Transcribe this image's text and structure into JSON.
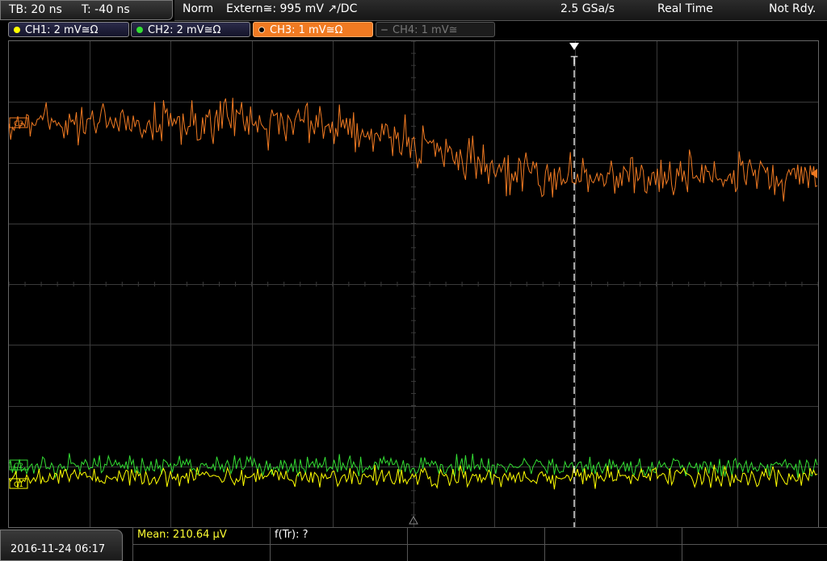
{
  "timebase": {
    "tb_label": "TB: 20 ns",
    "t_label": "T: -40 ns"
  },
  "status": {
    "trigger_mode": "Norm",
    "trigger_source": "Extern≅: 995 mV ↗/DC",
    "sample_rate": "2.5 GSa/s",
    "acq_mode": "Real Time",
    "ready_state": "Not Rdy."
  },
  "channels": [
    {
      "label": "CH1: 2 mV≅Ω",
      "color": "#ffff00",
      "state": "on"
    },
    {
      "label": "CH2: 2 mV≅Ω",
      "color": "#33dd33",
      "state": "on"
    },
    {
      "label": "CH3: 1 mV≅Ω",
      "color": "#f07a22",
      "state": "active"
    },
    {
      "label": "CH4: 1 mV≅",
      "color": "#777777",
      "state": "off"
    }
  ],
  "markers": {
    "ch3_marker": "C3",
    "trigger_marker": "T",
    "ch1_marker": "C1",
    "ch2_marker": "C2"
  },
  "colors": {
    "ch1": "#ffff00",
    "ch2": "#33dd33",
    "ch3": "#f07a22",
    "grid": "#3a3a3a"
  },
  "footer": {
    "datetime": "2016-11-24 06:17"
  },
  "measurements": {
    "mean": "Mean: 210.64 µV",
    "rise_freq": "f(Tr): ?"
  }
}
